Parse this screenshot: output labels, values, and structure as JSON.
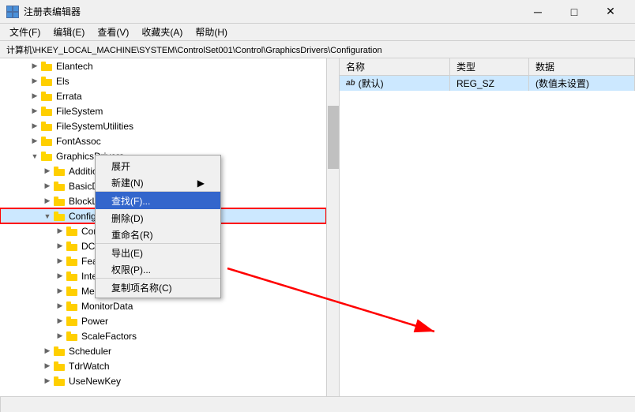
{
  "window": {
    "icon": "🔧",
    "title": "注册表编辑器",
    "min_btn": "─",
    "max_btn": "□",
    "close_btn": "✕"
  },
  "menu": {
    "items": [
      "文件(F)",
      "编辑(E)",
      "查看(V)",
      "收藏夹(A)",
      "帮助(H)"
    ]
  },
  "address": {
    "path": "计算机\\HKEY_LOCAL_MACHINE\\SYSTEM\\ControlSet001\\Control\\GraphicsDrivers\\Configuration"
  },
  "tree": {
    "items": [
      {
        "indent": 2,
        "expanded": false,
        "label": "Elantech"
      },
      {
        "indent": 2,
        "expanded": false,
        "label": "Els"
      },
      {
        "indent": 2,
        "expanded": false,
        "label": "Errata"
      },
      {
        "indent": 2,
        "expanded": false,
        "label": "FileSystem"
      },
      {
        "indent": 2,
        "expanded": false,
        "label": "FileSystemUtilities"
      },
      {
        "indent": 2,
        "expanded": false,
        "label": "FontAssoc"
      },
      {
        "indent": 2,
        "expanded": true,
        "label": "GraphicsDrivers",
        "open": true
      },
      {
        "indent": 3,
        "expanded": false,
        "label": "AdditionalModeLists"
      },
      {
        "indent": 3,
        "expanded": false,
        "label": "BasicDisplay"
      },
      {
        "indent": 3,
        "expanded": false,
        "label": "BlockList"
      },
      {
        "indent": 3,
        "expanded": false,
        "label": "Configuration",
        "selected": true,
        "highlighted": true
      },
      {
        "indent": 4,
        "expanded": false,
        "label": "Connectivity"
      },
      {
        "indent": 4,
        "expanded": false,
        "label": "DCI"
      },
      {
        "indent": 4,
        "expanded": false,
        "label": "FeatureSetUs..."
      },
      {
        "indent": 4,
        "expanded": false,
        "label": "InternalMon..."
      },
      {
        "indent": 4,
        "expanded": false,
        "label": "MemoryMan..."
      },
      {
        "indent": 4,
        "expanded": false,
        "label": "MonitorData"
      },
      {
        "indent": 4,
        "expanded": false,
        "label": "Power"
      },
      {
        "indent": 4,
        "expanded": false,
        "label": "ScaleFactors"
      },
      {
        "indent": 3,
        "expanded": false,
        "label": "Scheduler"
      },
      {
        "indent": 3,
        "expanded": false,
        "label": "TdrWatch"
      },
      {
        "indent": 3,
        "expanded": false,
        "label": "UseNewKey"
      }
    ]
  },
  "right_panel": {
    "columns": [
      "名称",
      "类型",
      "数据"
    ],
    "rows": [
      {
        "name": "(默认)",
        "type": "REG_SZ",
        "data": "(数值未设置)"
      }
    ],
    "name_icon": "ab"
  },
  "context_menu": {
    "items": [
      {
        "label": "展开",
        "shortcut": "",
        "arrow": false,
        "divider": false
      },
      {
        "label": "新建(N)",
        "shortcut": "",
        "arrow": true,
        "divider": true
      },
      {
        "label": "查找(F)...",
        "shortcut": "",
        "arrow": false,
        "divider": false,
        "highlighted": true
      },
      {
        "label": "删除(D)",
        "shortcut": "",
        "arrow": false,
        "divider": false
      },
      {
        "label": "重命名(R)",
        "shortcut": "",
        "arrow": false,
        "divider": true
      },
      {
        "label": "导出(E)",
        "shortcut": "",
        "arrow": false,
        "divider": false
      },
      {
        "label": "权限(P)...",
        "shortcut": "",
        "arrow": false,
        "divider": true
      },
      {
        "label": "复制项名称(C)",
        "shortcut": "",
        "arrow": false,
        "divider": false
      }
    ]
  }
}
